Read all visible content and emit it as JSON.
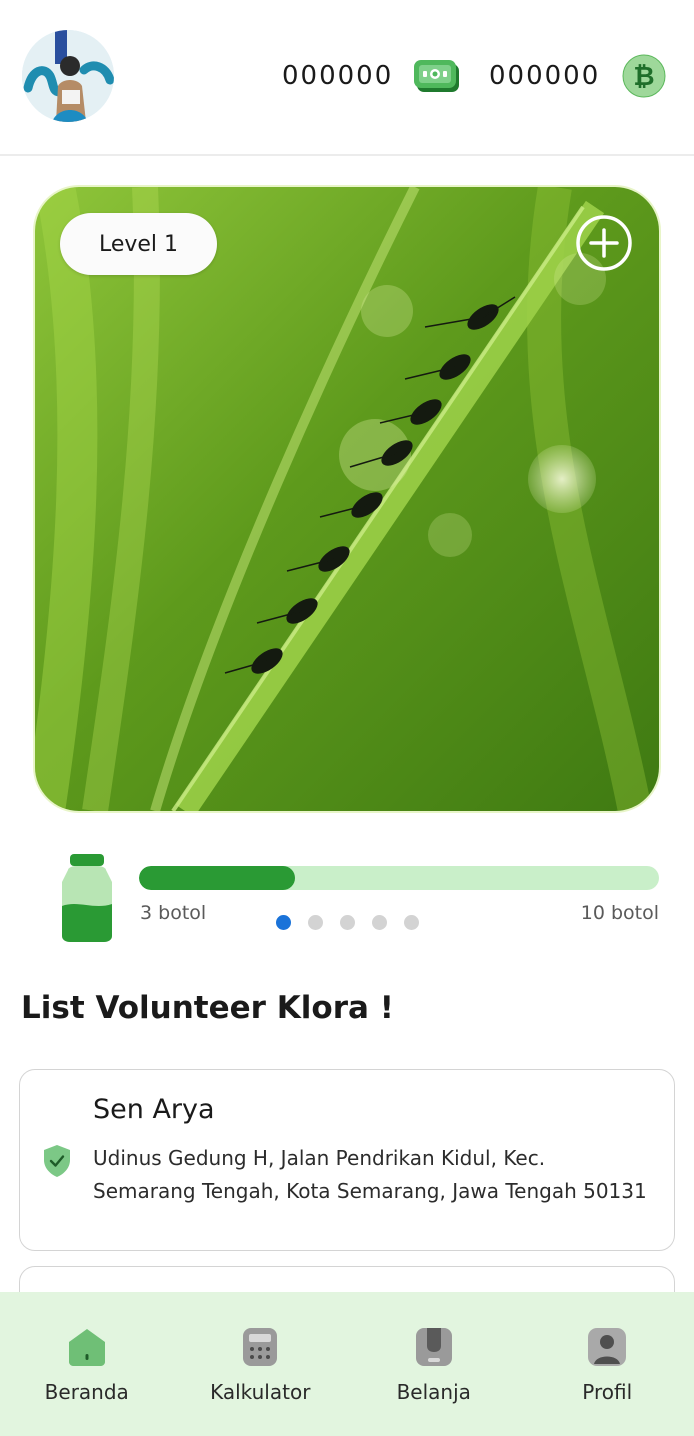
{
  "header": {
    "avatar_icon": "user-avatar-icon",
    "money_value": "000000",
    "money_icon": "banknote-icon",
    "bitcoin_value": "000000",
    "bitcoin_icon": "bitcoin-icon"
  },
  "hero": {
    "level_label": "Level 1",
    "add_icon": "plus-circle-icon"
  },
  "progress": {
    "icon": "bottle-icon",
    "current_label": "3 botol",
    "max_label": "10 botol",
    "value": 3,
    "max": 10
  },
  "carousel": {
    "count": 5,
    "active_index": 0
  },
  "volunteers": {
    "title": "List Volunteer Klora !",
    "items": [
      {
        "name": "Sen Arya",
        "address": "Udinus Gedung H, Jalan Pendrikan Kidul, Kec. Semarang Tengah, Kota Semarang, Jawa Tengah 50131",
        "icon": "verified-shield-icon"
      }
    ]
  },
  "bottom_nav": {
    "items": [
      {
        "label": "Beranda",
        "icon": "home-icon"
      },
      {
        "label": "Kalkulator",
        "icon": "calculator-icon"
      },
      {
        "label": "Belanja",
        "icon": "shopping-bag-icon"
      },
      {
        "label": "Profil",
        "icon": "profile-icon"
      }
    ]
  },
  "colors": {
    "accent": "#2a9a34",
    "progress_track": "#c9efc9",
    "nav_background": "#e2f5df",
    "active_dot": "#1a73d9"
  }
}
